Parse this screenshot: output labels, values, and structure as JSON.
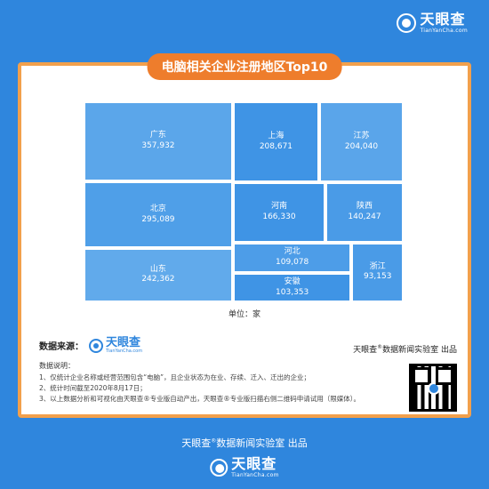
{
  "header": {
    "brand": "天眼查",
    "brand_sub": "TianYanCha.com"
  },
  "chart_data": {
    "type": "treemap",
    "title": "电脑相关企业注册地区Top10",
    "unit_label": "单位：家",
    "items": [
      {
        "name": "广东",
        "value": 357932,
        "label": "357,932"
      },
      {
        "name": "北京",
        "value": 295089,
        "label": "295,089"
      },
      {
        "name": "山东",
        "value": 242362,
        "label": "242,362"
      },
      {
        "name": "上海",
        "value": 208671,
        "label": "208,671"
      },
      {
        "name": "江苏",
        "value": 204040,
        "label": "204,040"
      },
      {
        "name": "河南",
        "value": 166330,
        "label": "166,330"
      },
      {
        "name": "陕西",
        "value": 140247,
        "label": "140,247"
      },
      {
        "name": "河北",
        "value": 109078,
        "label": "109,078"
      },
      {
        "name": "安徽",
        "value": 103353,
        "label": "103,353"
      },
      {
        "name": "浙江",
        "value": 93153,
        "label": "93,153"
      }
    ],
    "colors": {
      "广东": "#5ba6ea",
      "北京": "#4f9fe8",
      "山东": "#61aaeb",
      "上海": "#3f94e5",
      "江苏": "#5aa5ea",
      "河南": "#3f94e5",
      "陕西": "#4a9be7",
      "河北": "#4d9de8",
      "安徽": "#3f94e5",
      "浙江": "#4a9be7"
    }
  },
  "source": {
    "label": "数据来源：",
    "brand": "天眼查",
    "brand_sub": "TianYanCha.com",
    "publisher": "天眼查",
    "publisher_rest": "数据新闻实验室 出品"
  },
  "notes": {
    "heading": "数据说明：",
    "lines": [
      "1、仅统计企业名称或经营范围包含“电脑”，且企业状态为在业、存续、迁入、迁出的企业；",
      "2、统计时间截至2020年8月17日；",
      "3、以上数据分析和可视化由天眼查®专业版自动产出，天眼查®专业版扫描右侧二维码申请试用（限媒体）。"
    ]
  },
  "footer": {
    "publisher": "天眼查",
    "publisher_rest": "数据新闻实验室 出品",
    "brand": "天眼查",
    "brand_sub": "TianYanCha.com"
  }
}
